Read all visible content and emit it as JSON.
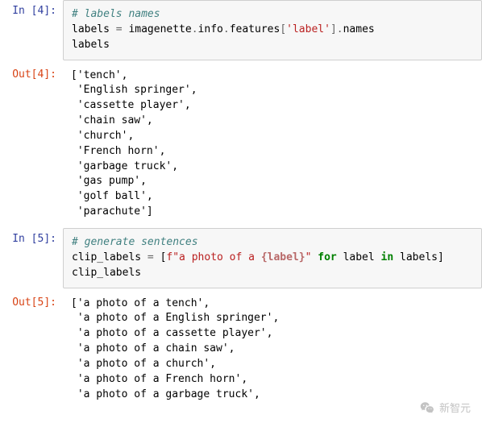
{
  "cells": {
    "0": {
      "prompt": "In [4]:",
      "code": {
        "comment": "# labels names",
        "line2_parts": {
          "a": "labels ",
          "b": "=",
          "c": " imagenette",
          "d": ".",
          "e": "info",
          "f": ".",
          "g": "features",
          "h": "[",
          "i": "'label'",
          "j": "]",
          "k": ".",
          "l": "names"
        },
        "line3": "labels"
      }
    },
    "1": {
      "prompt": "Out[4]:",
      "output": "['tench',\n 'English springer',\n 'cassette player',\n 'chain saw',\n 'church',\n 'French horn',\n 'garbage truck',\n 'gas pump',\n 'golf ball',\n 'parachute']"
    },
    "2": {
      "prompt": "In [5]:",
      "code": {
        "comment": "# generate sentences",
        "line2_parts": {
          "a": "clip_labels ",
          "b": "=",
          "c": " [",
          "d": "f",
          "e": "\"a photo of a ",
          "f": "{label}",
          "g": "\"",
          "h": " ",
          "i": "for",
          "j": " label ",
          "k": "in",
          "l": " labels]"
        },
        "line3": "clip_labels"
      }
    },
    "3": {
      "prompt": "Out[5]:",
      "output": "['a photo of a tench',\n 'a photo of a English springer',\n 'a photo of a cassette player',\n 'a photo of a chain saw',\n 'a photo of a church',\n 'a photo of a French horn',\n 'a photo of a garbage truck',"
    }
  },
  "watermark": "新智元"
}
